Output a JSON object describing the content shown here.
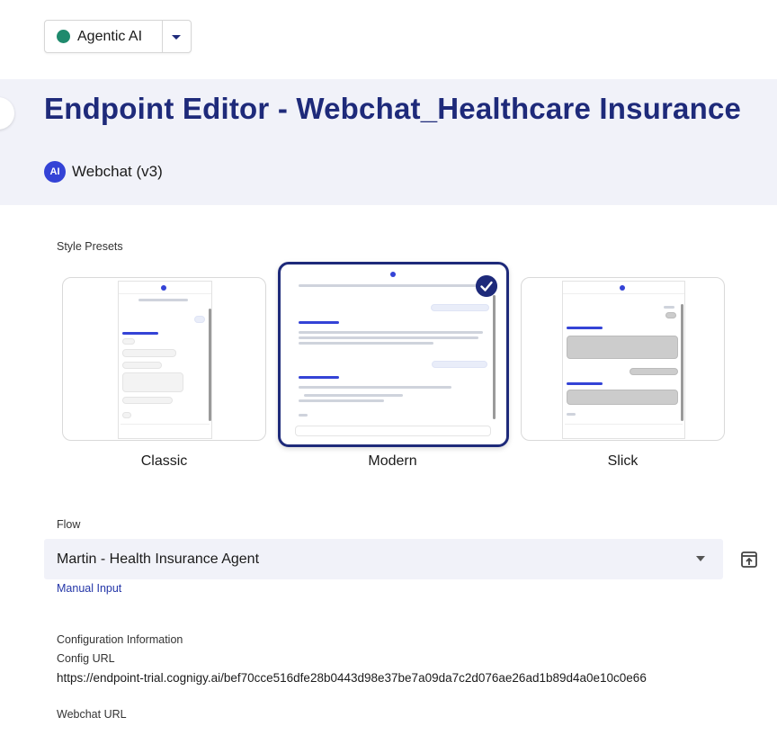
{
  "project": {
    "name": "Agentic AI",
    "status_color": "#1f8a6d"
  },
  "header": {
    "title": "Endpoint Editor - Webchat_Healthcare Insurance",
    "endpoint_type_logo": "AI",
    "endpoint_type": "Webchat (v3)",
    "background_color": "#f1f2f9",
    "title_color": "#1e2a7a"
  },
  "style_presets": {
    "label": "Style Presets",
    "selected": "Modern",
    "items": [
      {
        "name": "Classic",
        "selected": false
      },
      {
        "name": "Modern",
        "selected": true
      },
      {
        "name": "Slick",
        "selected": false
      }
    ]
  },
  "flow": {
    "label": "Flow",
    "selected_value": "Martin - Health Insurance Agent",
    "manual_input_link": "Manual Input"
  },
  "configuration": {
    "heading": "Configuration Information",
    "config_url_label": "Config URL",
    "config_url_value": "https://endpoint-trial.cognigy.ai/bef70cce516dfe28b0443d98e37be7a09da7c2d076ae26ad1b89d4a0e10c0e66",
    "webchat_url_label": "Webchat URL"
  },
  "accent_color": "#1e2a7a",
  "link_color": "#2436a8"
}
